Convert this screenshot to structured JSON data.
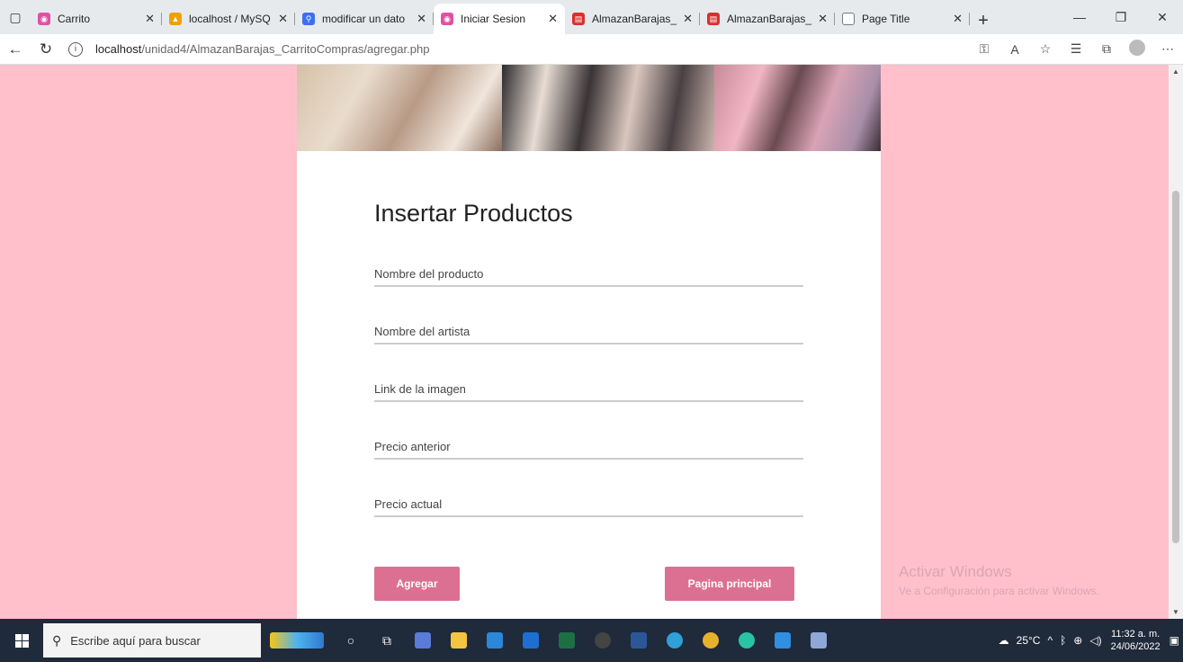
{
  "browser": {
    "tabs": [
      {
        "title": "Carrito",
        "color": "#e04fa6",
        "active": false
      },
      {
        "title": "localhost / MySQ",
        "color": "#f0a000",
        "active": false
      },
      {
        "title": "modificar un dato",
        "color": "#3c6ff0",
        "active": false
      },
      {
        "title": "Iniciar Sesion",
        "color": "#e04fa6",
        "active": true
      },
      {
        "title": "AlmazanBarajas_",
        "color": "#d9302c",
        "active": false
      },
      {
        "title": "AlmazanBarajas_",
        "color": "#d9302c",
        "active": false
      },
      {
        "title": "Page Title",
        "color": "#777777",
        "active": false
      }
    ],
    "url_host": "localhost",
    "url_path": "/unidad4/AlmazanBarajas_CarritoCompras/agregar.php"
  },
  "page": {
    "background": "#ffc0cb",
    "accent": "#db7093",
    "form": {
      "title": "Insertar Productos",
      "fields": [
        {
          "label": "Nombre del producto"
        },
        {
          "label": "Nombre del artista"
        },
        {
          "label": "Link de la imagen"
        },
        {
          "label": "Precio anterior"
        },
        {
          "label": "Precio actual"
        }
      ],
      "add_button": "Agregar",
      "home_button": "Pagina principal"
    },
    "watermark": {
      "line1": "Activar Windows",
      "line2": "Ve a Configuración para activar Windows."
    }
  },
  "taskbar": {
    "search_placeholder": "Escribe aquí para buscar",
    "weather": "25°C",
    "time": "11:32 a. m.",
    "date": "24/06/2022"
  }
}
